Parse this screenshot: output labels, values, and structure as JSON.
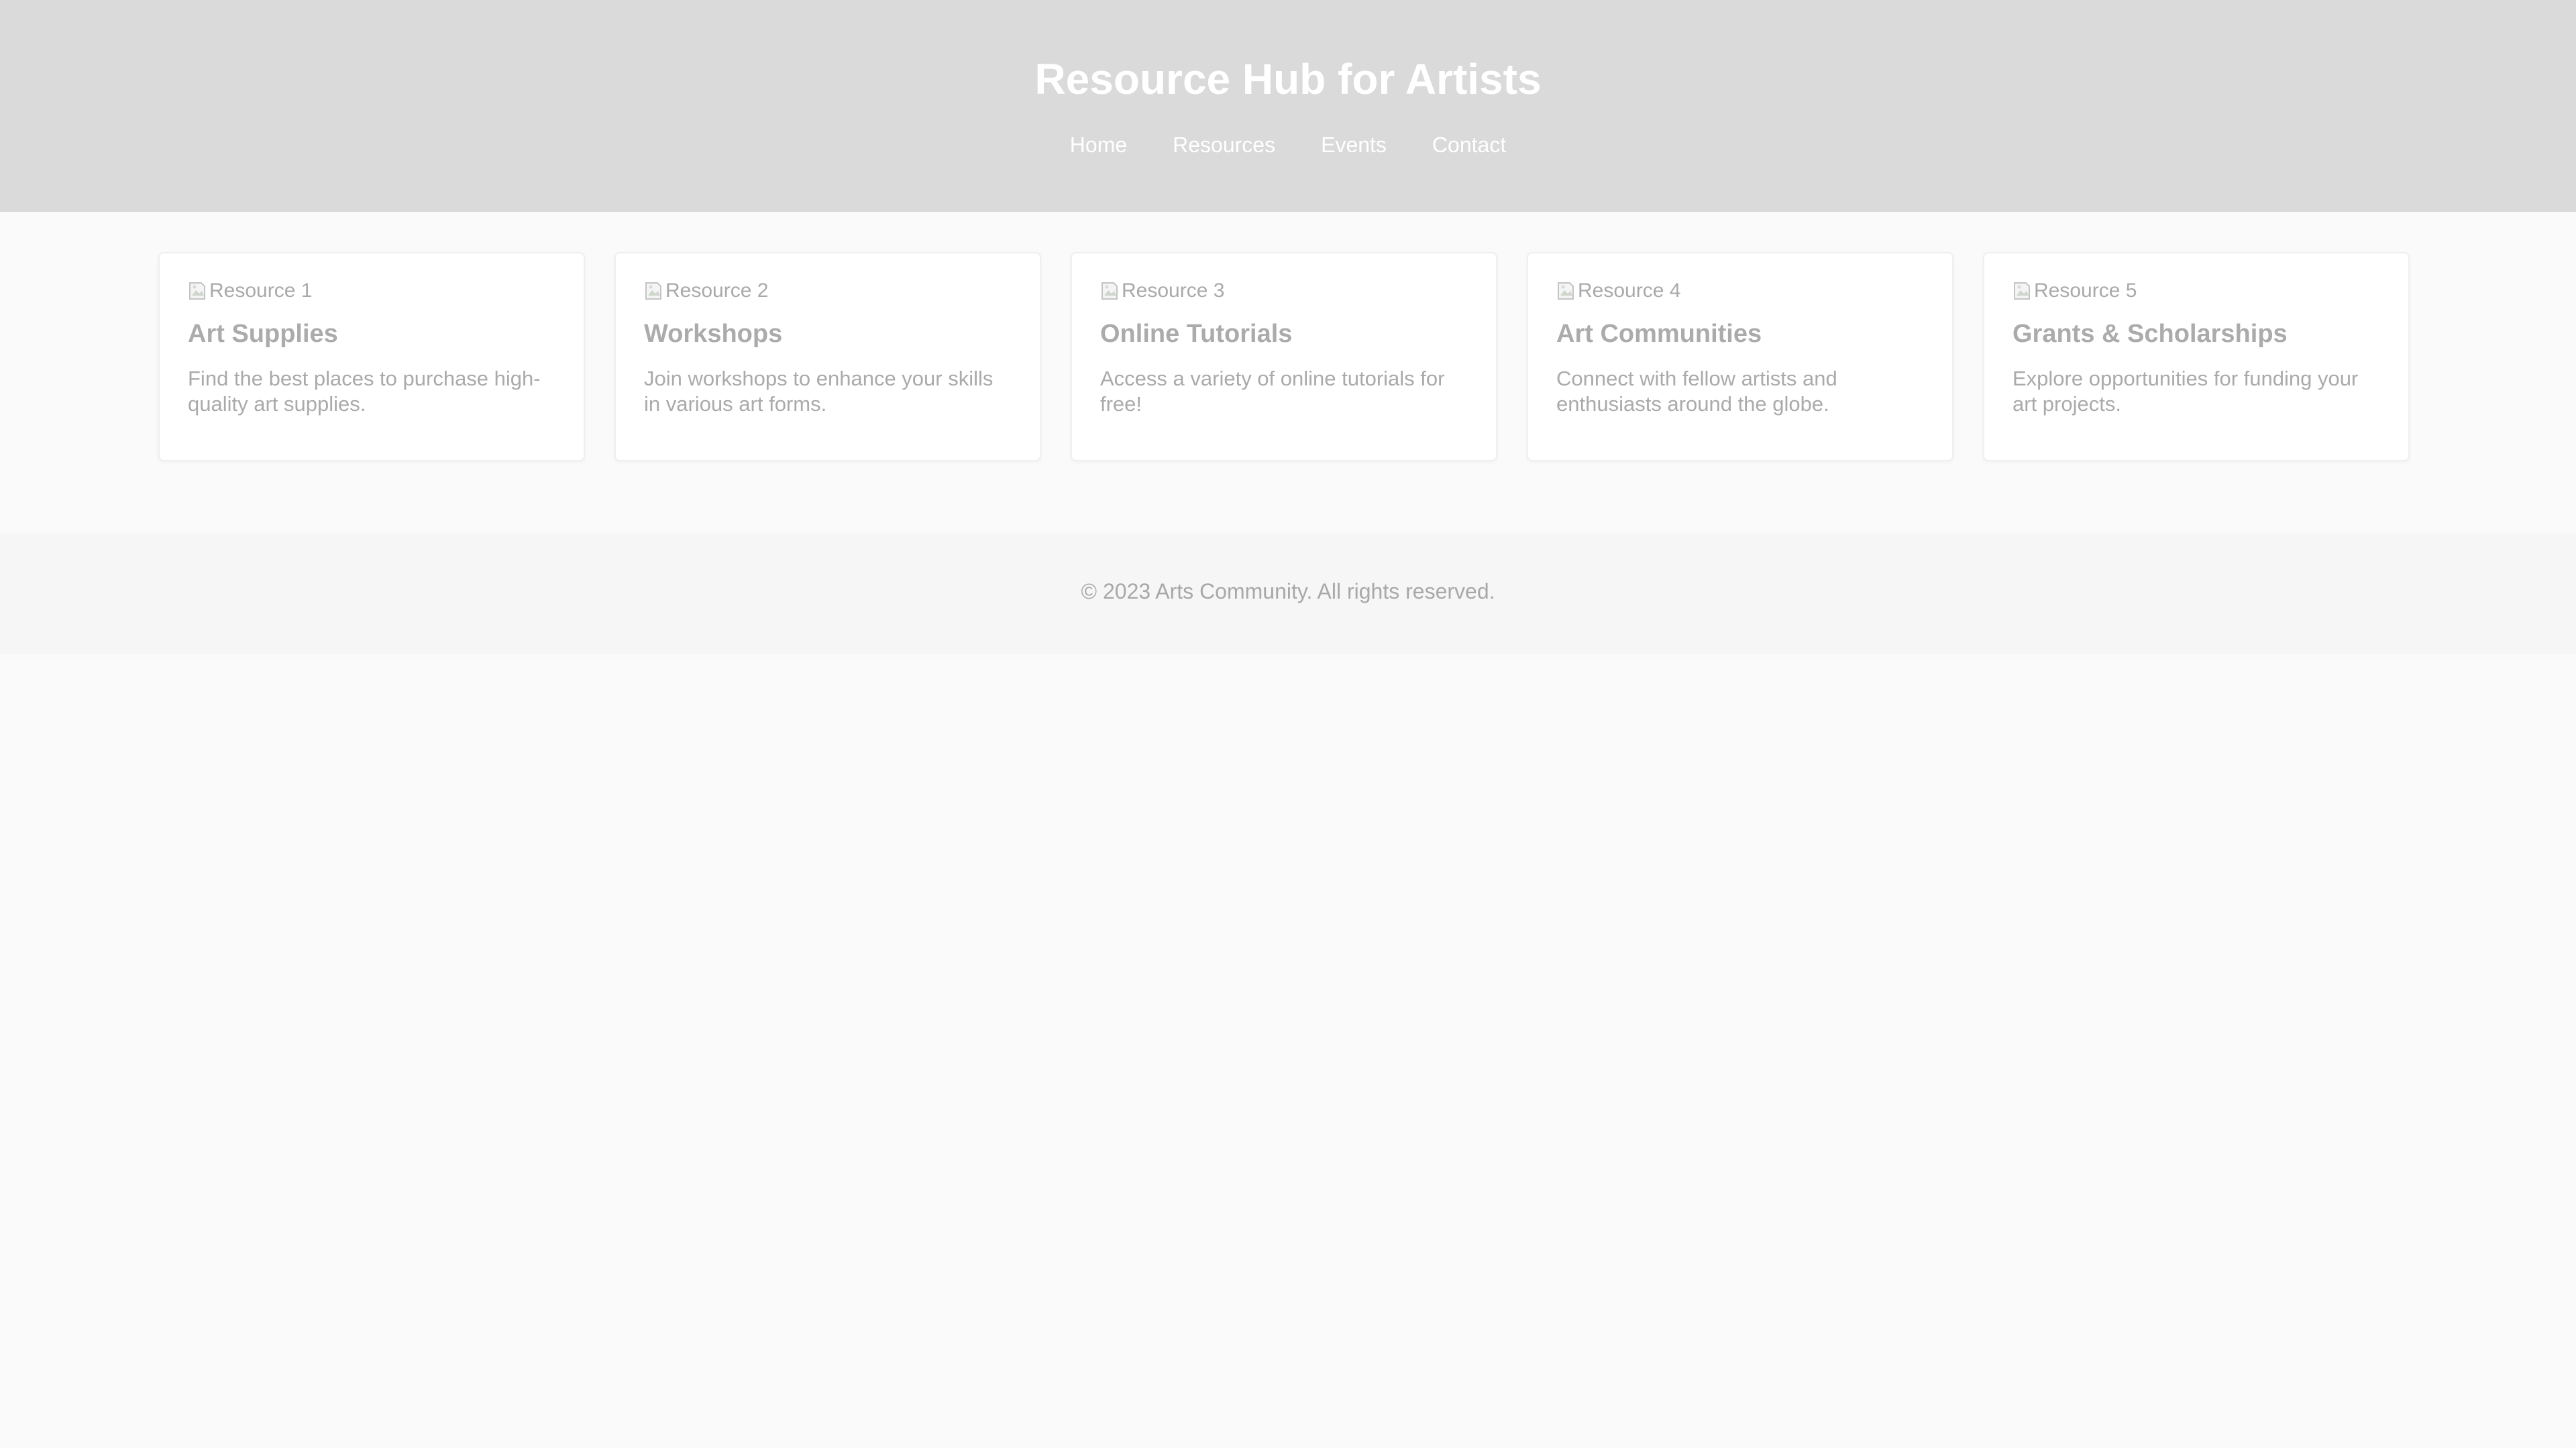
{
  "header": {
    "title": "Resource Hub for Artists",
    "nav": [
      "Home",
      "Resources",
      "Events",
      "Contact"
    ]
  },
  "resources": [
    {
      "image_alt": "Resource 1",
      "title": "Art Supplies",
      "description": "Find the best places to purchase high-quality art supplies."
    },
    {
      "image_alt": "Resource 2",
      "title": "Workshops",
      "description": "Join workshops to enhance your skills in various art forms."
    },
    {
      "image_alt": "Resource 3",
      "title": "Online Tutorials",
      "description": "Access a variety of online tutorials for free!"
    },
    {
      "image_alt": "Resource 4",
      "title": "Art Communities",
      "description": "Connect with fellow artists and enthusiasts around the globe."
    },
    {
      "image_alt": "Resource 5",
      "title": "Grants & Scholarships",
      "description": "Explore opportunities for funding your art projects."
    }
  ],
  "footer": {
    "text": "© 2023 Arts Community. All rights reserved."
  },
  "icons": {
    "card_image": "broken-image-icon"
  },
  "colors": {
    "header_bg": "#dadada",
    "page_bg": "#fafafa",
    "footer_bg": "#f6f6f6"
  }
}
